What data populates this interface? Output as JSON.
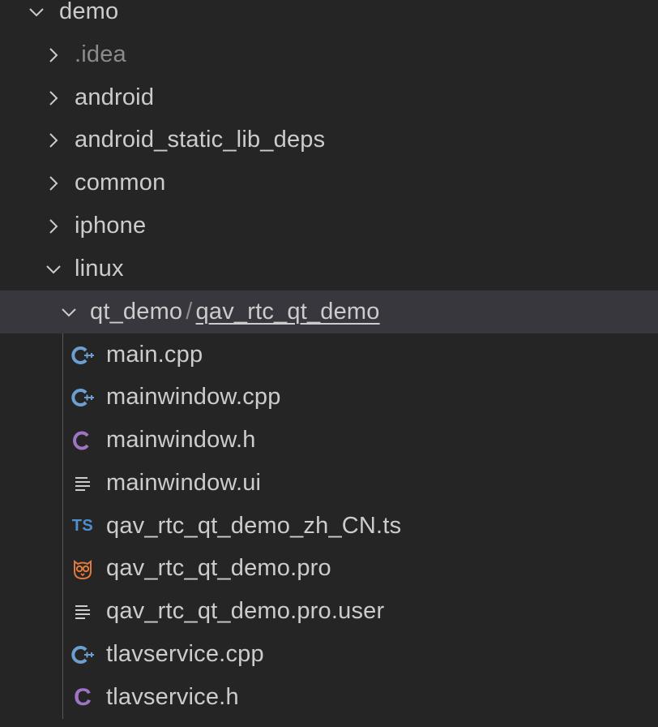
{
  "explorer": {
    "root": {
      "label": "demo",
      "expanded": true
    },
    "folders": [
      {
        "label": ".idea",
        "expanded": false,
        "dimmed": true
      },
      {
        "label": "android",
        "expanded": false
      },
      {
        "label": "android_static_lib_deps",
        "expanded": false
      },
      {
        "label": "common",
        "expanded": false
      },
      {
        "label": "iphone",
        "expanded": false
      },
      {
        "label": "linux",
        "expanded": true
      }
    ],
    "compact_folder": {
      "parent": "qt_demo",
      "separator": "/",
      "child": "qav_rtc_qt_demo",
      "expanded": true,
      "selected": true
    },
    "files": [
      {
        "label": "main.cpp",
        "icon": "cpp-icon"
      },
      {
        "label": "mainwindow.cpp",
        "icon": "cpp-icon"
      },
      {
        "label": "mainwindow.h",
        "icon": "c-header-icon"
      },
      {
        "label": "mainwindow.ui",
        "icon": "text-lines-icon"
      },
      {
        "label": "qav_rtc_qt_demo_zh_CN.ts",
        "icon": "typescript-icon",
        "icon_text": "TS"
      },
      {
        "label": "qav_rtc_qt_demo.pro",
        "icon": "owl-icon"
      },
      {
        "label": "qav_rtc_qt_demo.pro.user",
        "icon": "text-lines-icon"
      },
      {
        "label": "tlavservice.cpp",
        "icon": "cpp-icon"
      },
      {
        "label": "tlavservice.h",
        "icon": "c-header-icon",
        "icon_text": "C"
      }
    ],
    "colors": {
      "background": "#252526",
      "selected_row": "#37373d",
      "text": "#cccccc",
      "dim_text": "#8b8b8b",
      "cpp_icon": "#6c9fd0",
      "c_icon": "#a074c4",
      "ts_icon": "#4f8fcf",
      "owl_icon": "#e07a3c"
    }
  }
}
